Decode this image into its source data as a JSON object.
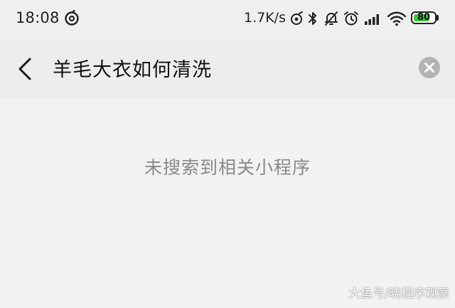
{
  "status_bar": {
    "time": "18:08",
    "network_speed": "1.7K/s",
    "battery_level": "80",
    "battery_fraction": 0.8,
    "icons": [
      "netease-music-icon",
      "hotspot-icon",
      "bluetooth-icon",
      "mute-icon",
      "alarm-icon",
      "signal-icon",
      "wifi-icon",
      "battery-icon"
    ]
  },
  "search": {
    "query": "羊毛大衣如何清洗"
  },
  "results": {
    "empty_message": "未搜索到相关小程序"
  },
  "watermark": "大鱼号/晓程序观察",
  "colors": {
    "battery_green": "#3cc436",
    "empty_text": "#8a8a8a",
    "clear_button": "#b3b3b3"
  }
}
